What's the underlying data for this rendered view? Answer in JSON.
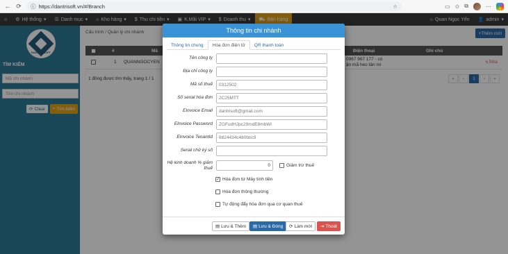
{
  "browser": {
    "url": "https://dantrisoft.vn/#/Branch"
  },
  "nav": {
    "home_icon": "home-icon",
    "items": [
      "Hệ thống",
      "Danh mục",
      "Kho hàng",
      "Thu chi tiền",
      "K.Mãi VIP",
      "Doanh thu",
      "Bán hàng"
    ],
    "user": "Quan Ngọc Yến",
    "admin": "admin"
  },
  "sidebar": {
    "logo_text": "DAN TRI SOFT",
    "title": "TÌM KIẾM",
    "code_placeholder": "Mã chi nhánh",
    "name_placeholder": "Tên chi nhánh",
    "clear_label": "Clear",
    "search_label": "Tìm kiếm"
  },
  "main": {
    "breadcrumb_1": "Cấu hình",
    "breadcrumb_2": "Quản lý chi nhánh",
    "add_label": "Thêm mới",
    "headers": [
      "#",
      "Mã",
      "Điện thoại",
      "Ghi chú"
    ],
    "row": {
      "index": "1",
      "code": "QUANNGOCYEN",
      "phone_1": "0967 967 177 - có",
      "phone_2": "ận mã heo tân mi",
      "edit_label": "Sửa"
    },
    "info": "1 đồng được tìm thấy, trang 1 / 1",
    "pager": [
      "«",
      "‹",
      "1",
      "›",
      "»"
    ]
  },
  "modal": {
    "title": "Thông tin chi nhánh",
    "tabs": [
      "Thông tin chung",
      "Hóa đơn điện tử",
      "QR thanh toán"
    ],
    "active_tab": 1,
    "fields": {
      "company_name": {
        "label": "Tên công ty",
        "value": ""
      },
      "company_address": {
        "label": "Địa chỉ công ty",
        "value": ""
      },
      "tax_code": {
        "label": "Mã số thuế",
        "value": "0312502"
      },
      "serial": {
        "label": "Số serial hóa đơn",
        "value": "2C25MTT"
      },
      "email": {
        "label": "EInvoice Email",
        "value": "dantrisoft@gmail.com"
      },
      "password": {
        "label": "EInvoice Password",
        "value": "ZGFudHJpc29mdE8mbWl"
      },
      "tenant": {
        "label": "EInvoice TenantId",
        "value": "6824434c480bbc9"
      },
      "signature_serial": {
        "label": "Serial chữ ký số",
        "value": ""
      },
      "tax_rate": {
        "label": "Hệ kinh doanh % giảm thuế",
        "value": "0"
      }
    },
    "checkboxes": {
      "tax_reduction": {
        "label": "Giảm trừ thuế",
        "checked": false
      },
      "cash_register": {
        "label": "Hóa đơn từ Máy tính tiền",
        "checked": true
      },
      "regular": {
        "label": "Hóa đơn thông thường",
        "checked": false
      },
      "auto_push": {
        "label": "Tự động đẩy hóa đơn qua cơ quan thuế",
        "checked": false
      }
    },
    "buttons": {
      "save_add": "Lưu & Thêm",
      "save_close": "Lưu & Đóng",
      "reset": "Làm mới",
      "exit": "Thoát"
    }
  },
  "colors": {
    "header_blue": "#3a93d6",
    "primary": "#2b6aa8",
    "danger": "#d9534f",
    "sidebar": "#2c7a98",
    "nav_active": "#e3a21a"
  }
}
